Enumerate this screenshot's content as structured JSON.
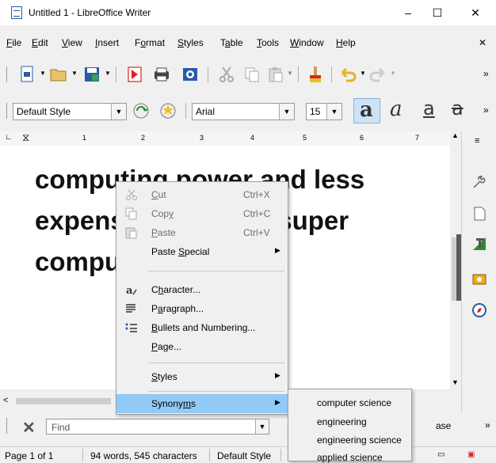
{
  "window": {
    "title": "Untitled 1 - LibreOffice Writer",
    "minimize": "–",
    "maximize": "☐",
    "close": "✕"
  },
  "menubar": {
    "items": [
      {
        "pre": "",
        "u": "F",
        "post": "ile"
      },
      {
        "pre": "",
        "u": "E",
        "post": "dit"
      },
      {
        "pre": "",
        "u": "V",
        "post": "iew"
      },
      {
        "pre": "",
        "u": "I",
        "post": "nsert"
      },
      {
        "pre": "F",
        "u": "o",
        "post": "rmat"
      },
      {
        "pre": "",
        "u": "S",
        "post": "tyles"
      },
      {
        "pre": "T",
        "u": "a",
        "post": "ble"
      },
      {
        "pre": "",
        "u": "T",
        "post": "ools"
      },
      {
        "pre": "",
        "u": "W",
        "post": "indow"
      },
      {
        "pre": "",
        "u": "H",
        "post": "elp"
      }
    ],
    "close": "✕"
  },
  "toolbar": {
    "more": "»"
  },
  "formatting": {
    "paragraph_style": "Default Style",
    "font_name": "Arial",
    "font_size": "15",
    "more": "»"
  },
  "ruler": {
    "marks": [
      "1",
      "2",
      "3",
      "4",
      "5",
      "6",
      "7"
    ]
  },
  "document": {
    "lines": [
      "computing power and less",
      "expensive than the super",
      "computers."
    ]
  },
  "context_menu": {
    "cut": {
      "u": "C",
      "rest": "ut",
      "shortcut": "Ctrl+X"
    },
    "copy": {
      "pre": "Cop",
      "u": "y",
      "shortcut": "Ctrl+C"
    },
    "paste": {
      "u": "P",
      "rest": "aste",
      "shortcut": "Ctrl+V"
    },
    "paste_special": {
      "pre": "Paste ",
      "u": "S",
      "rest": "pecial"
    },
    "character": {
      "pre": "C",
      "u": "h",
      "rest": "aracter..."
    },
    "paragraph": {
      "pre": "P",
      "u": "a",
      "rest": "ragraph..."
    },
    "bullets": {
      "u": "B",
      "rest": "ullets and Numbering..."
    },
    "page": {
      "u": "P",
      "rest": "age..."
    },
    "styles": {
      "u": "S",
      "rest": "tyles"
    },
    "synonyms": {
      "pre": "Synony",
      "u": "m",
      "rest": "s"
    },
    "arrow": "▶"
  },
  "synonyms": [
    "computer science",
    "engineering",
    "engineering science",
    "applied science"
  ],
  "findbar": {
    "placeholder": "Find",
    "trailing": "ase",
    "more": "»",
    "close": "✕"
  },
  "statusbar": {
    "page": "Page 1 of 1",
    "words": "94 words, 545 characters",
    "style": "Default Style"
  }
}
